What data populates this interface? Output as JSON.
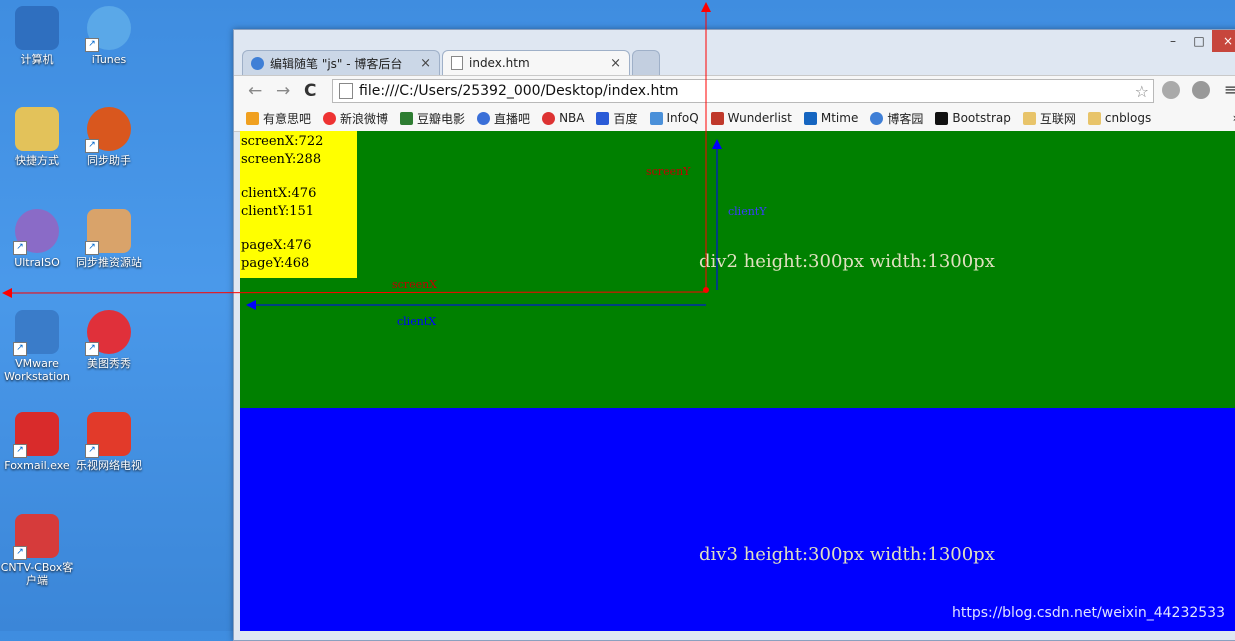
{
  "desktop": {
    "icons": [
      {
        "label": "计算机",
        "color": "#2f6fbf"
      },
      {
        "label": "iTunes",
        "color": "#5aa8e8"
      },
      {
        "label": "快捷方式",
        "color": "#e3c25a"
      },
      {
        "label": "同步助手",
        "color": "#d9571e"
      },
      {
        "label": "UltraISO",
        "color": "#8a6bc7"
      },
      {
        "label": "同步推资源站",
        "color": "#d9a36a"
      },
      {
        "label": "VMware Workstation",
        "color": "#3a7cc9"
      },
      {
        "label": "美图秀秀",
        "color": "#e0303a"
      },
      {
        "label": "Foxmail.exe",
        "color": "#d92b2b"
      },
      {
        "label": "乐视网络电视",
        "color": "#e23a2a"
      },
      {
        "label": "CNTV-CBox客户端",
        "color": "#d63b3b"
      }
    ]
  },
  "browser": {
    "tabs": [
      {
        "title": "编辑随笔 \"js\" - 博客后台",
        "close": "×"
      },
      {
        "title": "index.htm",
        "close": "×"
      }
    ],
    "controls": {
      "minimize": "–",
      "maximize": "□",
      "close": "×"
    },
    "nav": {
      "back": "←",
      "forward": "→",
      "reload": "C"
    },
    "url": "file:///C:/Users/25392_000/Desktop/index.htm",
    "bookmarks": [
      {
        "label": "有意思吧",
        "color": "#f0a020"
      },
      {
        "label": "新浪微博",
        "color": "#e33"
      },
      {
        "label": "豆瓣电影",
        "color": "#2e7d32"
      },
      {
        "label": "直播吧",
        "color": "#3a6fd8"
      },
      {
        "label": "NBA",
        "color": "#d33"
      },
      {
        "label": "百度",
        "color": "#2a5bd7"
      },
      {
        "label": "InfoQ",
        "color": "#4a90d9"
      },
      {
        "label": "Wunderlist",
        "color": "#c0392b"
      },
      {
        "label": "Mtime",
        "color": "#1565c0"
      },
      {
        "label": "博客园",
        "color": "#3f7fd6"
      },
      {
        "label": "Bootstrap",
        "color": "#111"
      },
      {
        "label": "互联网",
        "color": "#e8c46a"
      },
      {
        "label": "cnblogs",
        "color": "#e8c46a"
      }
    ],
    "more": "»"
  },
  "page": {
    "info": {
      "screenX": "screenX:722",
      "screenY": "screenY:288",
      "clientX": "clientX:476",
      "clientY": "clientY:151",
      "pageX": "pageX:476",
      "pageY": "pageY:468"
    },
    "div2_label": "div2 height:300px width:1300px",
    "div3_label": "div3 height:300px width:1300px",
    "colors": {
      "div2": "#008000",
      "div3": "#0000ff",
      "info": "#ffff00"
    }
  },
  "annotations": {
    "screenX": "screenX",
    "screenY": "screenY",
    "clientX": "clientX",
    "clientY": "clientY"
  },
  "watermark": "https://blog.csdn.net/weixin_44232533"
}
